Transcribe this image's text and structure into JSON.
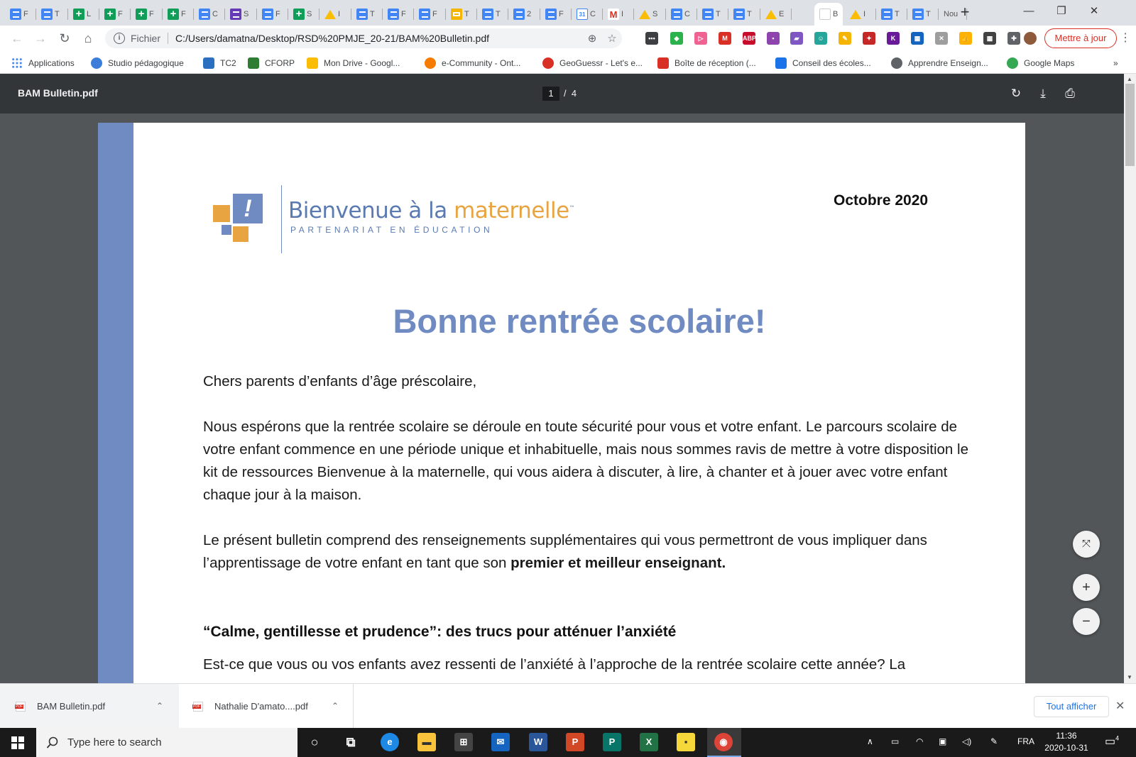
{
  "window": {
    "tabs": [
      {
        "label": "F",
        "icon": "doc-icon"
      },
      {
        "label": "T",
        "icon": "doc-icon"
      },
      {
        "label": "L",
        "icon": "sheet-icon"
      },
      {
        "label": "F",
        "icon": "sheet-icon"
      },
      {
        "label": "F",
        "icon": "sheet-icon"
      },
      {
        "label": "F",
        "icon": "sheet-icon"
      },
      {
        "label": "C",
        "icon": "doc-icon"
      },
      {
        "label": "S",
        "icon": "form-icon"
      },
      {
        "label": "F",
        "icon": "doc-icon"
      },
      {
        "label": "S",
        "icon": "sheet-icon"
      },
      {
        "label": "I",
        "icon": "drive-icon"
      },
      {
        "label": "T",
        "icon": "doc-icon"
      },
      {
        "label": "F",
        "icon": "doc-icon"
      },
      {
        "label": "F",
        "icon": "doc-icon"
      },
      {
        "label": "T",
        "icon": "slide-icon"
      },
      {
        "label": "T",
        "icon": "doc-icon"
      },
      {
        "label": "2",
        "icon": "doc-icon"
      },
      {
        "label": "F",
        "icon": "doc-icon"
      },
      {
        "label": "C",
        "icon": "calendar-icon"
      },
      {
        "label": "I",
        "icon": "gmail-icon"
      },
      {
        "label": "S",
        "icon": "drive-icon"
      },
      {
        "label": "C",
        "icon": "doc-icon"
      },
      {
        "label": "T",
        "icon": "doc-icon"
      },
      {
        "label": "T",
        "icon": "doc-icon"
      },
      {
        "label": "E",
        "icon": "drive-icon"
      },
      {
        "label": "B",
        "icon": "pdf-icon",
        "active": true
      },
      {
        "label": "I",
        "icon": "drive-icon"
      },
      {
        "label": "T",
        "icon": "doc-icon"
      },
      {
        "label": "T",
        "icon": "doc-icon"
      },
      {
        "label": "Nou",
        "icon": "none"
      }
    ],
    "new_tab": "+",
    "minimize": "—",
    "restore": "❐",
    "close": "✕"
  },
  "toolbar": {
    "back": "←",
    "forward": "→",
    "reload": "↻",
    "home": "⌂",
    "info_glyph": "i",
    "scheme": "Fichier",
    "url": "C:/Users/damatna/Desktop/RSD%20PMJE_20-21/BAM%20Bulletin.pdf",
    "zoom_glyph": "⊕",
    "star_glyph": "☆",
    "update_label": "Mettre à jour",
    "menu_glyph": "⋮",
    "extensions": [
      {
        "name": "ext-dots-icon",
        "color": "#3c4043",
        "text": "•••"
      },
      {
        "name": "ext-feedly-icon",
        "color": "#2bb24c",
        "text": "◆"
      },
      {
        "name": "ext-arrow-icon",
        "color": "#f06292",
        "text": "▷"
      },
      {
        "name": "ext-gmail-icon",
        "color": "#d93025",
        "text": "M"
      },
      {
        "name": "ext-abp-icon",
        "color": "#c70d2c",
        "text": "ABP"
      },
      {
        "name": "ext-puzzle-purple-icon",
        "color": "#8e44ad",
        "text": "▪"
      },
      {
        "name": "ext-bookmark-icon",
        "color": "#7e57c2",
        "text": "▰"
      },
      {
        "name": "ext-screencast-icon",
        "color": "#26a69a",
        "text": "☺"
      },
      {
        "name": "ext-palette-icon",
        "color": "#f4b400",
        "text": "✎"
      },
      {
        "name": "ext-red-square-icon",
        "color": "#c62828",
        "text": "✦"
      },
      {
        "name": "ext-kami-icon",
        "color": "#6a1b9a",
        "text": "K"
      },
      {
        "name": "ext-grid-color-icon",
        "color": "#1565c0",
        "text": "▦"
      },
      {
        "name": "ext-loom-icon",
        "color": "#9e9e9e",
        "text": "✕"
      },
      {
        "name": "ext-thumb-icon",
        "color": "#ffb300",
        "text": "👍"
      },
      {
        "name": "ext-grid-icon",
        "color": "#424242",
        "text": "▦"
      },
      {
        "name": "extensions-puzzle-icon",
        "color": "#5f6368",
        "text": "✚"
      }
    ]
  },
  "bookmarks": [
    {
      "label": "Applications",
      "icon": "apps-grid-icon",
      "color": "#4285f4"
    },
    {
      "label": "Studio pédagogique",
      "icon": "studio-icon",
      "color": "#3b7dd8"
    },
    {
      "label": "TC2",
      "icon": "tc2-icon",
      "color": "#2a6fc0"
    },
    {
      "label": "CFORP",
      "icon": "cforp-icon",
      "color": "#2e7d32"
    },
    {
      "label": "Mon Drive - Googl...",
      "icon": "drive-icon",
      "color": "#fbbc04"
    },
    {
      "label": "e-Community - Ont...",
      "icon": "ecommunity-icon",
      "color": "#f57c00"
    },
    {
      "label": "GeoGuessr - Let's e...",
      "icon": "location-pin-icon",
      "color": "#d93025"
    },
    {
      "label": "Boîte de réception (...",
      "icon": "gmail-icon",
      "color": "#d93025"
    },
    {
      "label": "Conseil des écoles...",
      "icon": "calendar-icon",
      "color": "#1a73e8"
    },
    {
      "label": "Apprendre Enseign...",
      "icon": "globe-icon",
      "color": "#5f6368"
    },
    {
      "label": "Google Maps",
      "icon": "maps-pin-icon",
      "color": "#34a853"
    }
  ],
  "bookmarks_more": "»",
  "pdf": {
    "title": "BAM Bulletin.pdf",
    "page_current": "1",
    "page_sep": "/",
    "page_total": "4",
    "rotate_glyph": "↻",
    "download_glyph": "⤓",
    "print_glyph": "⎙"
  },
  "document": {
    "logo_name_part1": "Bienvenue à la ",
    "logo_name_part2": "maternelle",
    "logo_tm": "™",
    "logo_exclamation": "!",
    "logo_tagline": "PARTENARIAT EN ÉDUCATION",
    "date": "Octobre 2020",
    "heading": "Bonne rentrée scolaire!",
    "greeting": "Chers parents d’enfants d’âge préscolaire,",
    "paragraph1": "Nous espérons que la rentrée scolaire se déroule en toute sécurité pour vous et votre enfant.  Le parcours scolaire de votre enfant commence en une période unique et inhabituelle, mais nous sommes ravis de mettre à votre disposition le kit de ressources Bienvenue à la maternelle, qui vous aidera à discuter, à lire, à chanter et à jouer avec votre enfant chaque jour à la maison.",
    "paragraph2_start": "Le présent bulletin comprend des renseignements supplémentaires qui vous permettront de vous impliquer dans l’apprentissage de votre enfant en tant que son ",
    "paragraph2_bold": "premier et meilleur enseignant.",
    "subheading": "“Calme, gentillesse et prudence”: des trucs pour atténuer l’anxiété",
    "paragraph3": "Est-ce que vous ou vos enfants avez ressenti de l’anxiété à l’approche de la rentrée scolaire cette année? La"
  },
  "zoom": {
    "fit_glyph": "⤧",
    "in_glyph": "+",
    "out_glyph": "−"
  },
  "downloads": {
    "items": [
      {
        "name": "BAM Bulletin.pdf"
      },
      {
        "name": "Nathalie D'amato....pdf"
      }
    ],
    "chevron": "⌃",
    "show_all": "Tout afficher",
    "close": "✕"
  },
  "taskbar": {
    "search_placeholder": "Type here to search",
    "apps": [
      {
        "name": "cortana-icon",
        "text": "○",
        "color": "#1a1a1a"
      },
      {
        "name": "task-view-icon",
        "text": "⧉",
        "color": "#1a1a1a"
      },
      {
        "name": "edge-icon",
        "text": "e",
        "color": "#1e88e5"
      },
      {
        "name": "file-explorer-icon",
        "text": "▬",
        "color": "#f9c33c"
      },
      {
        "name": "store-icon",
        "text": "⊞",
        "color": "#444"
      },
      {
        "name": "mail-icon",
        "text": "✉",
        "color": "#1565c0"
      },
      {
        "name": "word-icon",
        "text": "W",
        "color": "#2b579a"
      },
      {
        "name": "powerpoint-icon",
        "text": "P",
        "color": "#d24726"
      },
      {
        "name": "publisher-icon",
        "text": "P",
        "color": "#077568"
      },
      {
        "name": "excel-icon",
        "text": "X",
        "color": "#217346"
      },
      {
        "name": "sticky-notes-icon",
        "text": "▪",
        "color": "#f7d83b"
      },
      {
        "name": "chrome-icon",
        "text": "◉",
        "color": "#db4437"
      }
    ],
    "tray": {
      "chevron": "∧",
      "battery": "▭",
      "wifi": "◠",
      "network": "▣",
      "volume": "◁)",
      "pen": "✎",
      "language": "FRA"
    },
    "time": "11:36",
    "date": "2020-10-31",
    "notifications_count": "4"
  }
}
